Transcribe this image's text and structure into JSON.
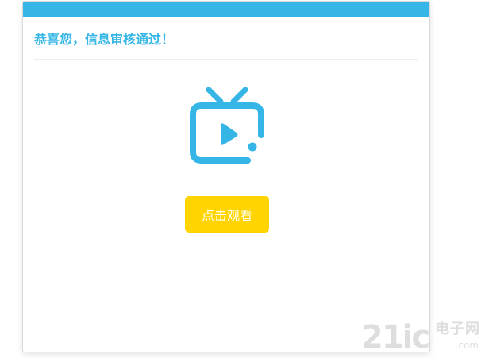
{
  "card": {
    "title": "恭喜您，信息审核通过！",
    "button_label": "点击观看",
    "icon": "tv-play-icon"
  },
  "watermark": {
    "number": "21ic",
    "brand": "电子网",
    "url": ".com"
  },
  "colors": {
    "accent": "#36b6e6",
    "button": "#ffd400",
    "button_text": "#ffffff"
  }
}
